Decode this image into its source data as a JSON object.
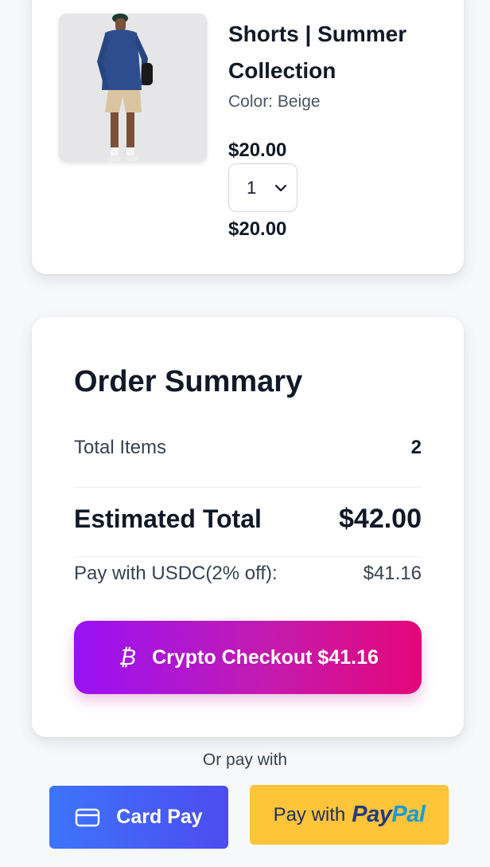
{
  "cart_item": {
    "name": "Shorts | Summer Collection",
    "color": "Color: Beige",
    "price": "$20.00",
    "quantity": "1",
    "subtotal": "$20.00"
  },
  "summary": {
    "title": "Order Summary",
    "total_items_label": "Total Items",
    "total_items_value": "2",
    "estimated_total_label": "Estimated Total",
    "estimated_total_value": "$42.00",
    "usdc_label": "Pay with USDC(2% off):",
    "usdc_value": "$41.16",
    "crypto_checkout_label": "Crypto Checkout $41.16",
    "crypto_icon": "bitcoin-icon"
  },
  "payment": {
    "or_pay_with": "Or pay with",
    "card_pay_label": "Card Pay",
    "card_icon": "credit-card-icon",
    "paypal_prefix": "Pay with",
    "paypal_logo_pay": "Pay",
    "paypal_logo_pal": "Pal"
  },
  "colors": {
    "crypto_gradient_start": "#9811f5",
    "crypto_gradient_end": "#e5067a",
    "card_pay_blue": "#3d74fb",
    "paypal_yellow": "#fec43a"
  }
}
